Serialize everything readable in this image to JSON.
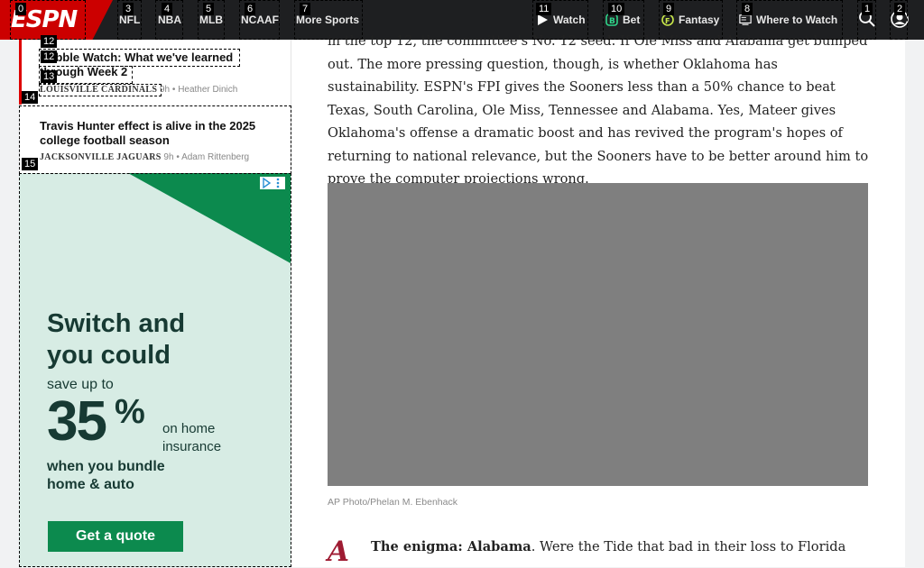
{
  "nav": {
    "logo": "ESPN",
    "links": [
      "NFL",
      "NBA",
      "MLB",
      "NCAAF",
      "More Sports"
    ],
    "right": {
      "watch": "Watch",
      "bet": "Bet",
      "fantasy": "Fantasy",
      "where_to_watch": "Where to Watch"
    },
    "icons": [
      "search-icon",
      "account-icon",
      "play-icon",
      "bet-icon",
      "fantasy-icon",
      "tv-guide-icon"
    ]
  },
  "tags": {
    "t0": "0",
    "t1": "1",
    "t2": "2",
    "t3": "3",
    "t4": "4",
    "t5": "5",
    "t6": "6",
    "t7": "7",
    "t8": "8",
    "t9": "9",
    "t10": "10",
    "t11": "11",
    "t12a": "12",
    "t12b": "12",
    "t13": "13",
    "t14": "14",
    "t15": "15"
  },
  "sidebar": {
    "stories": [
      {
        "title_line1": "Bubble Watch: What we've learned",
        "title_line2": "through Week 2",
        "team": "LOUISVILLE CARDINALS",
        "age": "9h",
        "author": "Heather Dinich"
      },
      {
        "title_line1": "Travis Hunter effect is alive in the 2025",
        "title_line2": "college football season",
        "team": "JACKSONVILLE JAGUARS",
        "age": "9h",
        "author": "Adam Rittenberg"
      }
    ]
  },
  "ad": {
    "headline_1": "Switch and",
    "headline_2": "you could",
    "save": "save up to",
    "percent": "35",
    "percent_sym": "%",
    "home_1": "on home",
    "home_2": "insurance",
    "bundle_1": "when you bundle",
    "bundle_2": "home & auto",
    "cta": "Get a quote",
    "brand_color": "#0c8a4e"
  },
  "article": {
    "para_top": "in the top 12, the committee's No. 12 seed. If Ole Miss and Alabama get bumped out. The more pressing question, though, is whether Oklahoma has sustainability. ESPN's FPI gives the Sooners less than a 50% chance to beat Texas, South Carolina, Ole Miss, Tennessee and Alabama. Yes, Mateer gives Oklahoma's offense a dramatic boost and has revived the program's hopes of returning to national relevance, but the Sooners have to be better around him to prove the computer projections wrong.",
    "photo_credit": "AP Photo/Phelan M. Ebenhack",
    "section_logo": "A",
    "enigma_bold": "The enigma: Alabama",
    "enigma_rest": ". Were the Tide that bad in their loss to Florida"
  }
}
